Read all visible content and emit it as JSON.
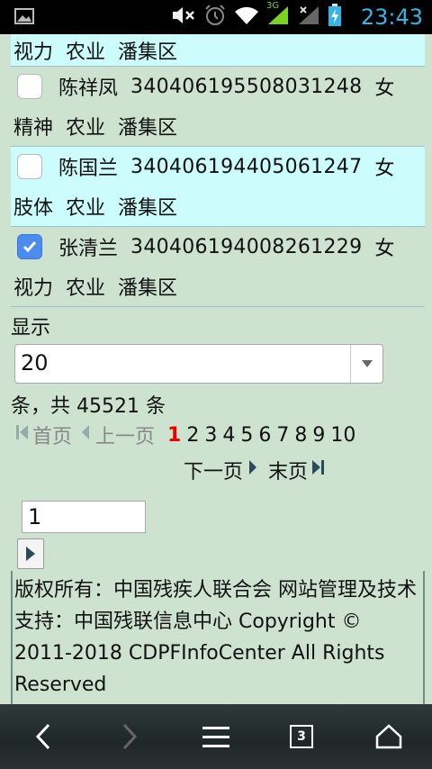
{
  "status_bar": {
    "time": "23:43",
    "network_label": "3G",
    "icons": [
      "image-icon",
      "mute-icon",
      "alarm-icon",
      "wifi-icon",
      "signal-icon",
      "signal-x-icon",
      "battery-charging-icon"
    ]
  },
  "first_row": {
    "type": "视力",
    "job": "农业",
    "district": "潘集区"
  },
  "records": [
    {
      "name": "陈祥凤",
      "id": "340406195508031248",
      "gender": "女",
      "type": "精神",
      "job": "农业",
      "district": "潘集区",
      "checked": false,
      "highlighted": false
    },
    {
      "name": "陈国兰",
      "id": "340406194405061247",
      "gender": "女",
      "type": "肢体",
      "job": "农业",
      "district": "潘集区",
      "checked": false,
      "highlighted": true
    },
    {
      "name": "张清兰",
      "id": "340406194008261229",
      "gender": "女",
      "type": "视力",
      "job": "农业",
      "district": "潘集区",
      "checked": true,
      "highlighted": false
    }
  ],
  "pagination": {
    "display_label": "显示",
    "page_size": "20",
    "total_text": "条，共 45521 条",
    "first": "首页",
    "prev": "上一页",
    "pages": [
      "1",
      "2",
      "3",
      "4",
      "5",
      "6",
      "7",
      "8",
      "9",
      "10"
    ],
    "current_page": "1",
    "next": "下一页",
    "last": "末页",
    "goto_value": "1"
  },
  "footer": {
    "text": "版权所有：中国残疾人联合会 网站管理及技术支持：中国残联信息中心 Copyright © 2011-2018 CDPFInfoCenter All Rights Reserved"
  },
  "nav_bar": {
    "tab_count": "3"
  },
  "colors": {
    "page_bg": "#cde3d0",
    "highlight_row": "#ccfcfc",
    "checkbox_checked": "#4a8cf0",
    "current_page": "#ee0000",
    "status_text": "#33b5e5"
  }
}
